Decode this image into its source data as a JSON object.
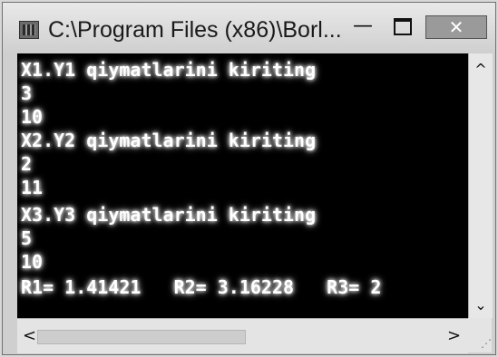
{
  "window": {
    "title": "C:\\Program Files (x86)\\Borl...",
    "minimize_label": "—",
    "close_label": "✕"
  },
  "console": {
    "lines": [
      "X1.Y1 qiymatlarini kiriting",
      "3",
      "10",
      "X2.Y2 qiymatlarini kiriting",
      "2",
      "11",
      "X3.Y3 qiymatlarini kiriting",
      "5",
      "10",
      "R1= 1.41421   R2= 3.16228   R3= 2"
    ]
  },
  "scrollbars": {
    "up_arrow": "^",
    "down_arrow": "⌄",
    "left_arrow": "<",
    "right_arrow": ">"
  }
}
